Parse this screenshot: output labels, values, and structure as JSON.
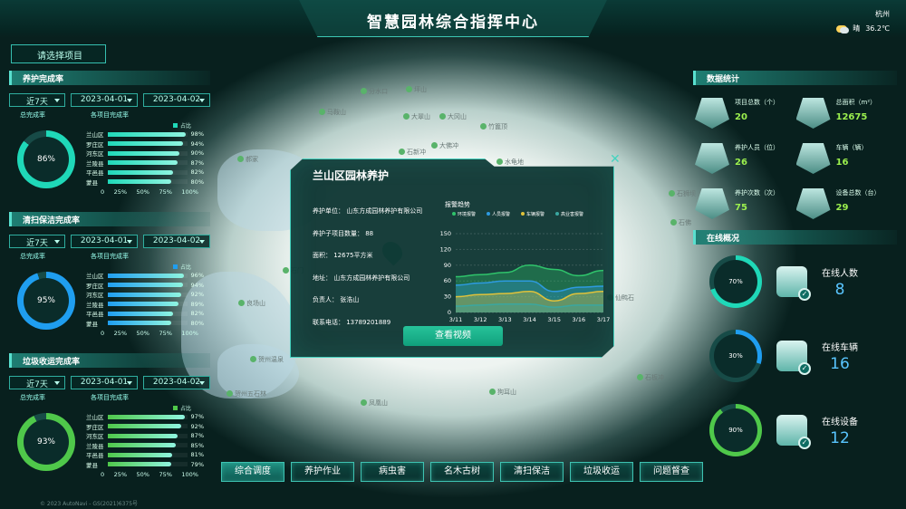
{
  "title": "智慧园林综合指挥中心",
  "weather": {
    "city": "杭州",
    "cond": "晴",
    "temp": "36.2℃"
  },
  "project_select": "请选择项目",
  "left_sections": [
    {
      "title": "养护完成率",
      "range": "近7天",
      "start": "2023-04-01",
      "end": "2023-04-02",
      "total_label": "总完成率",
      "sub_label": "各项目完成率",
      "legend": "占比",
      "total": "86%",
      "total_value": 86,
      "color": "#1fd8b8",
      "rows": [
        {
          "n": "兰山区",
          "v": "98%",
          "p": 98
        },
        {
          "n": "罗庄区",
          "v": "94%",
          "p": 94
        },
        {
          "n": "河东区",
          "v": "90%",
          "p": 90
        },
        {
          "n": "兰陵县",
          "v": "87%",
          "p": 87
        },
        {
          "n": "平邑县",
          "v": "82%",
          "p": 82
        },
        {
          "n": "蒙县",
          "v": "80%",
          "p": 80
        }
      ]
    },
    {
      "title": "清扫保洁完成率",
      "range": "近7天",
      "start": "2023-04-01",
      "end": "2023-04-02",
      "total_label": "总完成率",
      "sub_label": "各项目完成率",
      "legend": "占比",
      "total": "95%",
      "total_value": 95,
      "color": "#1f9ef0",
      "rows": [
        {
          "n": "兰山区",
          "v": "96%",
          "p": 96
        },
        {
          "n": "罗庄区",
          "v": "94%",
          "p": 94
        },
        {
          "n": "河东区",
          "v": "92%",
          "p": 92
        },
        {
          "n": "兰陵县",
          "v": "89%",
          "p": 89
        },
        {
          "n": "平邑县",
          "v": "82%",
          "p": 82
        },
        {
          "n": "蒙县",
          "v": "80%",
          "p": 80
        }
      ]
    },
    {
      "title": "垃圾收运完成率",
      "range": "近7天",
      "start": "2023-04-01",
      "end": "2023-04-02",
      "total_label": "总完成率",
      "sub_label": "各项目完成率",
      "legend": "占比",
      "total": "93%",
      "total_value": 93,
      "color": "#4fc84a",
      "rows": [
        {
          "n": "兰山区",
          "v": "97%",
          "p": 97
        },
        {
          "n": "罗庄区",
          "v": "92%",
          "p": 92
        },
        {
          "n": "河东区",
          "v": "87%",
          "p": 87
        },
        {
          "n": "兰陵县",
          "v": "85%",
          "p": 85
        },
        {
          "n": "平邑县",
          "v": "81%",
          "p": 81
        },
        {
          "n": "蒙县",
          "v": "79%",
          "p": 79
        }
      ]
    }
  ],
  "axis": [
    "0",
    "25%",
    "50%",
    "75%",
    "100%"
  ],
  "stats_title": "数据统计",
  "stats": [
    {
      "k": "项目总数（个）",
      "v": "20",
      "icon": "books-icon"
    },
    {
      "k": "总面积（m²）",
      "v": "12675",
      "icon": "area-icon"
    },
    {
      "k": "养护人员（位）",
      "v": "26",
      "icon": "workers-icon"
    },
    {
      "k": "车辆（辆）",
      "v": "16",
      "icon": "truck-icon"
    },
    {
      "k": "养护次数（次）",
      "v": "75",
      "icon": "bar-chart-icon"
    },
    {
      "k": "设备总数（台）",
      "v": "29",
      "icon": "pie-icon"
    }
  ],
  "online_title": "在线概况",
  "online": [
    {
      "pct": "70%",
      "p": 70,
      "k": "在线人数",
      "v": "8",
      "icon": "person-icon",
      "color": "#1fd8b8"
    },
    {
      "pct": "30%",
      "p": 30,
      "k": "在线车辆",
      "v": "16",
      "icon": "car-icon",
      "color": "#1f9ef0"
    },
    {
      "pct": "90%",
      "p": 90,
      "k": "在线设备",
      "v": "12",
      "icon": "device-icon",
      "color": "#4fc84a"
    }
  ],
  "popup": {
    "title": "兰山区园林养护",
    "info": [
      "养护单位：  山东方成园林养护有限公司",
      "养护子项目数量：  88",
      "面积：  12675平方米",
      "地址：  山东方成园林养护有限公司",
      "负责人：  张浩山",
      "联系电话：  13789201889"
    ],
    "trend_title": "报警趋势",
    "button": "查看视频"
  },
  "chart_data": {
    "type": "area",
    "x": [
      "3/11",
      "3/12",
      "3/13",
      "3/14",
      "3/15",
      "3/16",
      "3/17"
    ],
    "ylim": [
      0,
      150
    ],
    "yticks": [
      0,
      30,
      60,
      90,
      120,
      150
    ],
    "series": [
      {
        "name": "环境报警",
        "color": "#2fc36b",
        "values": [
          68,
          72,
          76,
          90,
          82,
          70,
          80
        ]
      },
      {
        "name": "人员报警",
        "color": "#2d9ae0",
        "values": [
          52,
          56,
          60,
          60,
          40,
          48,
          50
        ]
      },
      {
        "name": "车辆报警",
        "color": "#e0c23a",
        "values": [
          30,
          34,
          36,
          40,
          22,
          36,
          40
        ]
      },
      {
        "name": "高业害报警",
        "color": "#3aa7a0",
        "values": [
          12,
          14,
          16,
          16,
          10,
          14,
          14
        ]
      }
    ]
  },
  "nav": [
    "综合调度",
    "养护作业",
    "病虫害",
    "名木古树",
    "清扫保洁",
    "垃圾收运",
    "问题督查"
  ],
  "map_labels": [
    "分水口",
    "坪山",
    "马鞍山",
    "大翠山",
    "大冈山",
    "竹篦顶",
    "大佛冲",
    "水龟地",
    "郝家",
    "石狮坝",
    "石佛",
    "石门",
    "石板冲",
    "仙鸭石",
    "石新冲",
    "良场山",
    "贺州温泉",
    "贺州五石林",
    "凤凰山",
    "狗耳山"
  ],
  "footer": "© 2023 AutoNavi - GS(2021)6375号"
}
